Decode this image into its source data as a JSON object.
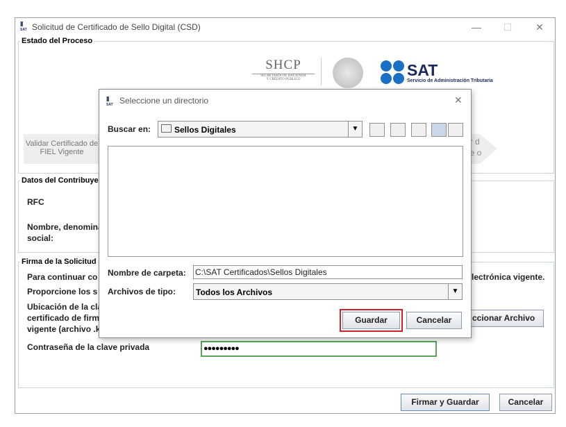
{
  "window": {
    "title": "Solicitud de Certificado de Sello Digital (CSD)",
    "logo_big": "II",
    "logo_small": "SAT",
    "minimize_icon": "—",
    "maximize_icon": "☐",
    "close_icon": "✕"
  },
  "process": {
    "title": "Estado del Proceso",
    "logos": {
      "shcp": "SHCP",
      "shcp_sub1": "SECRETARÍA DE HACIENDA",
      "shcp_sub2": "Y CRÉDITO PÚBLICO",
      "sat": "SAT",
      "sat_sub": "Servicio de Administración Tributaria"
    },
    "step1": "Validar Certificado de FIEL Vigente",
    "step_right": "ar d de o"
  },
  "taxpayer": {
    "title": "Datos del Contribuye",
    "rfc_label": "RFC",
    "name_label": "Nombre, denomina social:"
  },
  "signature": {
    "title": "Firma de la Solicitud",
    "line1_left": "Para continuar co",
    "line1_right": "lectrónica vigente.",
    "line2": "Proporcione los s",
    "location_label": "Ubicación de la cla certificado de firm vigente (archivo .k",
    "select_file_button": "ccionar Archivo",
    "password_label": "Contraseña de la clave privada",
    "password_value": "●●●●●●●●●"
  },
  "footer": {
    "sign_save": "Firmar y Guardar",
    "cancel": "Cancelar"
  },
  "dialog": {
    "title": "Seleccione un directorio",
    "look_in_label": "Buscar en:",
    "look_in_value": "Sellos Digitales",
    "folder_name_label": "Nombre de carpeta:",
    "folder_name_value": "C:\\SAT Certificados\\Sellos Digitales",
    "file_type_label": "Archivos de tipo:",
    "file_type_value": "Todos los Archivos",
    "save_button": "Guardar",
    "cancel_button": "Cancelar",
    "close_icon": "✕",
    "highlight_color": "#d0202a",
    "dropdown_icon": "▼"
  }
}
